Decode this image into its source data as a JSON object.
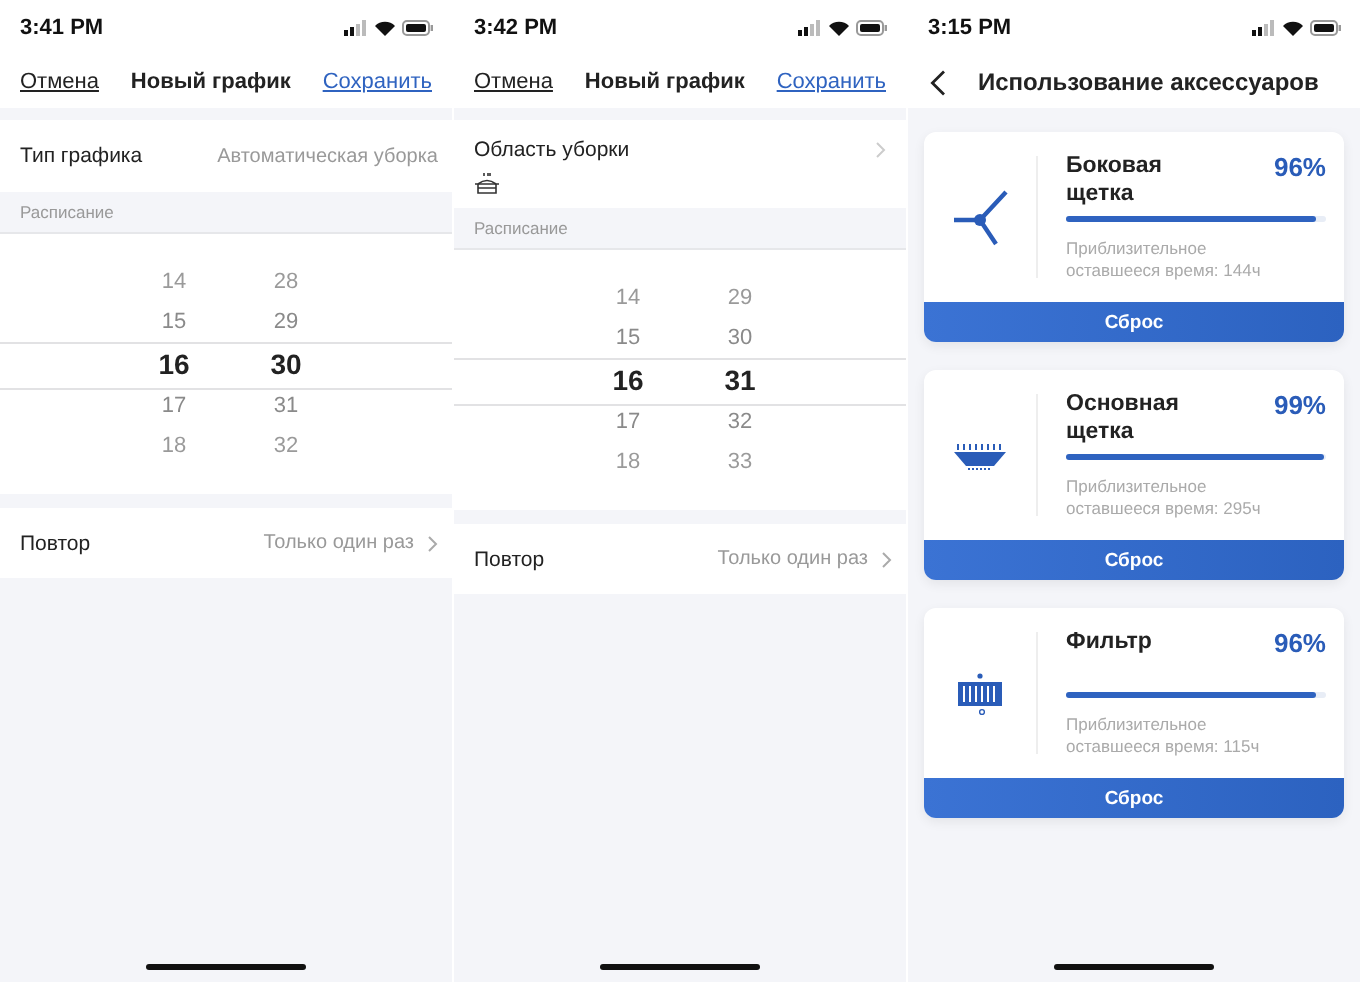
{
  "screens": [
    {
      "kind": "schedule",
      "status_time": "3:41 PM",
      "header": {
        "cancel": "Отмена",
        "title": "Новый график",
        "save": "Сохранить"
      },
      "items": [
        {
          "kind": "field",
          "label": "Тип графика",
          "value": "Автоматическая уборка"
        },
        {
          "kind": "section_header",
          "label": "Расписание"
        },
        {
          "kind": "picker",
          "columns": [
            {
              "values": [
                {
                  "text": "14",
                  "selected": false
                },
                {
                  "text": "15",
                  "selected": false
                },
                {
                  "text": "16",
                  "selected": true
                },
                {
                  "text": "17",
                  "selected": false
                },
                {
                  "text": "18",
                  "selected": false
                }
              ]
            },
            {
              "values": [
                {
                  "text": "28",
                  "selected": false
                },
                {
                  "text": "29",
                  "selected": false
                },
                {
                  "text": "30",
                  "selected": true
                },
                {
                  "text": "31",
                  "selected": false
                },
                {
                  "text": "32",
                  "selected": false
                }
              ]
            }
          ]
        },
        {
          "kind": "link",
          "label": "Повтор",
          "value": "Только один раз"
        }
      ]
    },
    {
      "kind": "schedule",
      "status_time": "3:42 PM",
      "header": {
        "cancel": "Отмена",
        "title": "Новый график",
        "save": "Сохранить"
      },
      "items": [
        {
          "kind": "area",
          "label": "Область уборки"
        },
        {
          "kind": "section_header",
          "label": "Расписание"
        },
        {
          "kind": "picker",
          "columns": [
            {
              "values": [
                {
                  "text": "14",
                  "selected": false
                },
                {
                  "text": "15",
                  "selected": false
                },
                {
                  "text": "16",
                  "selected": true
                },
                {
                  "text": "17",
                  "selected": false
                },
                {
                  "text": "18",
                  "selected": false
                }
              ]
            },
            {
              "values": [
                {
                  "text": "29",
                  "selected": false
                },
                {
                  "text": "30",
                  "selected": false
                },
                {
                  "text": "31",
                  "selected": true
                },
                {
                  "text": "32",
                  "selected": false
                },
                {
                  "text": "33",
                  "selected": false
                }
              ]
            }
          ]
        },
        {
          "kind": "link",
          "label": "Повтор",
          "value": "Только один раз"
        }
      ]
    },
    {
      "kind": "accessories",
      "status_time": "3:15 PM",
      "header": {
        "title": "Использование аксессуаров"
      },
      "cards": [
        {
          "kind": "side_brush",
          "name": "Боковая щетка",
          "percent": "96%",
          "level": 0.96,
          "remaining": "Приблизительное оставшееся время: 144ч",
          "reset": "Сброс"
        },
        {
          "kind": "main_brush",
          "name": "Основная щетка",
          "percent": "99%",
          "level": 0.99,
          "remaining": "Приблизительное оставшееся время: 295ч",
          "reset": "Сброс"
        },
        {
          "kind": "filter",
          "name": "Фильтр",
          "percent": "96%",
          "level": 0.96,
          "remaining": "Приблизительное оставшееся время: 115ч",
          "reset": "Сброс"
        }
      ]
    }
  ]
}
